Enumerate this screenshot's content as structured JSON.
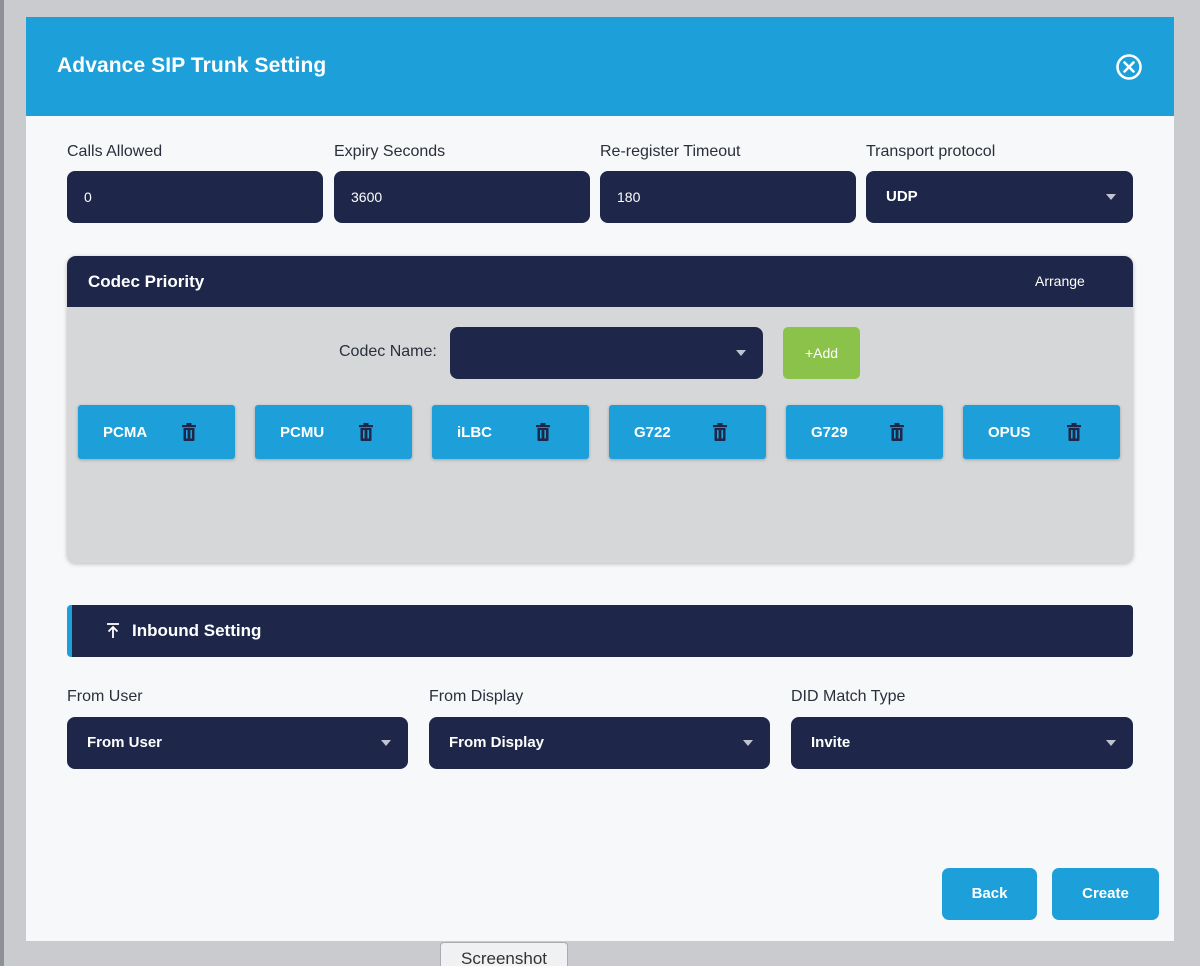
{
  "dialog": {
    "title": "Advance SIP Trunk Setting",
    "close_icon": "close-circle-icon"
  },
  "fields": {
    "calls_allowed": {
      "label": "Calls Allowed",
      "value": "0"
    },
    "expiry_seconds": {
      "label": "Expiry Seconds",
      "value": "3600"
    },
    "reregister_timeout": {
      "label": "Re-register Timeout",
      "value": "180"
    },
    "transport_protocol": {
      "label": "Transport protocol",
      "value": "UDP"
    }
  },
  "codec_priority": {
    "title": "Codec Priority",
    "arrange_label": "Arrange",
    "codec_name_label": "Codec Name:",
    "codec_name_value": "",
    "add_label": "+Add",
    "codecs": [
      "PCMA",
      "PCMU",
      "iLBC",
      "G722",
      "G729",
      "OPUS"
    ]
  },
  "inbound": {
    "title": "Inbound Setting",
    "icon": "collapse-up-icon",
    "from_user": {
      "label": "From User",
      "value": "From User"
    },
    "from_display": {
      "label": "From Display",
      "value": "From Display"
    },
    "did_match_type": {
      "label": "DID Match Type",
      "value": "Invite"
    }
  },
  "actions": {
    "back_label": "Back",
    "create_label": "Create"
  },
  "overlay": {
    "screenshot_label": "Screenshot"
  },
  "colors": {
    "header_blue": "#1da0d9",
    "navy": "#1e2749",
    "add_green": "#8bc34a",
    "panel_gray": "#d5d7d9"
  }
}
